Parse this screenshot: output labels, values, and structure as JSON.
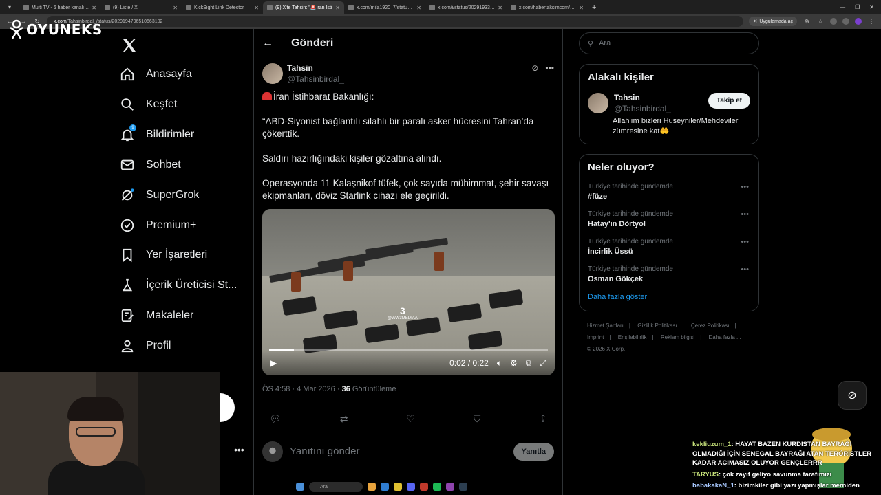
{
  "browser": {
    "tabs": [
      {
        "label": "Multi TV - 6 haber kanalını aynı",
        "active": false
      },
      {
        "label": "(9) Liste / X",
        "active": false
      },
      {
        "label": "KickSight Link Detector",
        "active": false
      },
      {
        "label": "(9) X'te Tahsin: \"🚨İran İsti",
        "active": true
      },
      {
        "label": "x.com/mila1920_7/status/20291",
        "active": false
      },
      {
        "label": "x.com/i/status/20291933401223",
        "active": false
      },
      {
        "label": "x.com/habertaksimcom/status/",
        "active": false
      }
    ],
    "address_host": "x.com",
    "address_path": "/Tahsinbirdal_/status/2029194796510663102",
    "open_in_app": "Uygulamada aç"
  },
  "overlay": {
    "logo_text": "OYUNEKS"
  },
  "nav": {
    "items": [
      {
        "label": "Anasayfa",
        "icon": "home-icon"
      },
      {
        "label": "Keşfet",
        "icon": "search-icon"
      },
      {
        "label": "Bildirimler",
        "icon": "bell-icon"
      },
      {
        "label": "Sohbet",
        "icon": "mail-icon"
      },
      {
        "label": "SuperGrok",
        "icon": "grok-icon"
      },
      {
        "label": "Premium+",
        "icon": "verified-icon"
      },
      {
        "label": "Yer İşaretleri",
        "icon": "bookmark-icon"
      },
      {
        "label": "İçerik Üreticisi St...",
        "icon": "creator-icon"
      },
      {
        "label": "Makaleler",
        "icon": "article-icon"
      },
      {
        "label": "Profil",
        "icon": "person-icon"
      }
    ],
    "notification_count": "9"
  },
  "post": {
    "header_title": "Gönderi",
    "author_name": "Tahsin",
    "author_handle": "@Tahsinbirdal_",
    "line1": "İran İstihbarat Bakanlığı:",
    "para1": "“ABD-Siyonist bağlantılı silahlı bir paralı asker hücresini Tahran’da çökerttik.",
    "para2": "Saldırı hazırlığındaki kişiler gözaltına alındı.",
    "para3": "Operasyonda 11 Kalaşnikof tüfek, çok sayıda mühimmat, şehir savaşı ekipmanları, döviz Starlink cihazı ele geçirildi.",
    "video_time": "0:02 / 0:22",
    "video_progress": 0.09,
    "video_watermark": "3",
    "video_watermark_sub": "@WW3MEDIAA",
    "timestamp": "ÖS 4:58 · 4 Mar 2026 · ",
    "views_count": "36",
    "views_label": " Görüntüleme",
    "reply_placeholder": "Yanıtını gönder",
    "reply_button": "Yanıtla"
  },
  "right": {
    "search_placeholder": "Ara",
    "related_title": "Alakalı kişiler",
    "related_name": "Tahsin",
    "related_handle": "@Tahsinbirdal_",
    "follow_label": "Takip et",
    "related_bio": "Allah'ım bizleri Huseyniler/Mehdeviler zümresine kat🤲",
    "trends_title": "Neler oluyor?",
    "trends": [
      {
        "meta": "Türkiye tarihinde gündemde",
        "name": "#füze"
      },
      {
        "meta": "Türkiye tarihinde gündemde",
        "name": "Hatay'ın Dörtyol"
      },
      {
        "meta": "Türkiye tarihinde gündemde",
        "name": "İncirlik Üssü"
      },
      {
        "meta": "Türkiye tarihinde gündemde",
        "name": "Osman Gökçek"
      }
    ],
    "show_more": "Daha fazla göster",
    "footer": [
      "Hizmet Şartları",
      "|",
      "Gizlilik Politikası",
      "|",
      "Çerez Politikası",
      "|",
      "Imprint",
      "|",
      "Erişilebilirlik",
      "|",
      "Reklam bilgisi",
      "|",
      "Daha fazla ...",
      "© 2026 X Corp."
    ]
  },
  "chat": [
    {
      "user": "kekliuzum_1",
      "text": ": HAYAT BAZEN KÜRDİSTAN BAYRAĞI OLMADIĞI İÇİN SENEGAL BAYRAĞI ATAN TERÖRİSTLER KADAR ACIMASIZ OLUYOR GENÇLERRR"
    },
    {
      "user": "TARYUS",
      "text": ": çok zayıf geliyo savunma tarafımızı"
    },
    {
      "user": "babakakaN_1",
      "text": ": bizimkiler gibi yazı yapmışlar merniden"
    }
  ],
  "taskbar": {
    "search_label": "Ara"
  }
}
